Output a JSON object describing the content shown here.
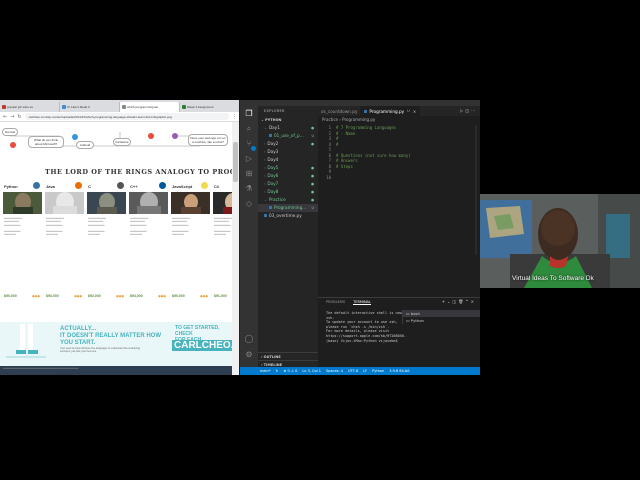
{
  "browser": {
    "tabs": [
      {
        "label": "popular job sites sa"
      },
      {
        "label": "If I Like It Read It"
      },
      {
        "label": "which-programming-lan"
      },
      {
        "label": "Week 4 Assignment"
      }
    ],
    "url": "carlcheo.com/wp-content/uploads/2014/12/which-programming-language-should-i-learn-first-infographic.png"
  },
  "infographic": {
    "flow_nodes": [
      "Not fast",
      "What do you think about Microsoft?",
      "Android",
      "Fantasize",
      "Once you start you finish it",
      "Do you use Mac or PC?",
      "Does your web app run on a machine, like a robot?"
    ],
    "title": "THE LORD OF THE RINGS ANALOGY TO PROGRAMMING",
    "cards": [
      {
        "lang": "Python",
        "salary": "$90,000"
      },
      {
        "lang": "Java",
        "salary": "$93,000"
      },
      {
        "lang": "C",
        "salary": "$92,000"
      },
      {
        "lang": "C++",
        "salary": "$94,000"
      },
      {
        "lang": "JavaScript",
        "salary": "$90,000"
      },
      {
        "lang": "C#",
        "salary": "$91,000"
      }
    ],
    "actually": "ACTUALLY...\nIT DOESN'T REALLY MATTER HOW\nYOU START.",
    "actually_sub": "Your need to know all these five languages to understand the underlying concepts, just pick your best one",
    "cta": "TO GET STARTED, CHECK\nFOR EACH PROGRAMMING",
    "brand": "CARLCHEO.COM"
  },
  "vscode": {
    "explorer_title": "EXPLORER",
    "root": "PYTHON",
    "tree": [
      {
        "label": "Day1",
        "type": "folder",
        "open": true,
        "mod": "●"
      },
      {
        "label": "01_use_of_p...",
        "type": "file",
        "mod": "U"
      },
      {
        "label": "Day2",
        "type": "folder",
        "mod": "●"
      },
      {
        "label": "Day3",
        "type": "folder",
        "mod": ""
      },
      {
        "label": "Day4",
        "type": "folder",
        "mod": ""
      },
      {
        "label": "Day5",
        "type": "folder",
        "mod": "●"
      },
      {
        "label": "Day6",
        "type": "folder",
        "mod": "●"
      },
      {
        "label": "Day7",
        "type": "folder",
        "mod": "●"
      },
      {
        "label": "Day8",
        "type": "folder",
        "mod": "●"
      },
      {
        "label": "Practice",
        "type": "folder",
        "open": true,
        "mod": "●"
      },
      {
        "label": "Programming...",
        "type": "file",
        "mod": "U"
      },
      {
        "label": "03_overtime.py",
        "type": "file",
        "mod": ""
      }
    ],
    "outline": "OUTLINE",
    "timeline": "TIMELINE",
    "tabs": [
      {
        "label": "os_countdown.py",
        "modified": "U"
      },
      {
        "label": "Programming.py",
        "modified": "U"
      }
    ],
    "breadcrumb": "Practice  ›  Programming.py",
    "code": [
      "# 7 Programming Languages",
      "# - Name",
      "#",
      "#",
      "",
      "# Questions (not sure how many)",
      "# Answers",
      "# Steps",
      "",
      ""
    ],
    "panel_tabs": [
      "PROBLEMS",
      "TERMINAL"
    ],
    "terminal_text": "The default interactive shell is now zsh.\nTo update your account to use zsh, please run `chsh -s /bin/zsh`.\nFor more details, please visit https://support.apple.com/kb/HT208050.\n(base) Vijos-iMac:Python vijosebe$ ",
    "terminals": [
      "bash",
      "Python"
    ],
    "status": [
      "main*",
      "↻",
      "⊗ 0  ⚠ 0",
      "Ln 3, Col 1",
      "Spaces: 4",
      "UTF-8",
      "LF",
      "Python",
      "3.9.6 64-bit"
    ]
  },
  "webcam": {
    "caption": "Virtual Ideas To Software Dk"
  },
  "colors": {
    "vscode_blue": "#007acc",
    "comment_green": "#6a9955",
    "infographic_teal": "#46b3be"
  }
}
